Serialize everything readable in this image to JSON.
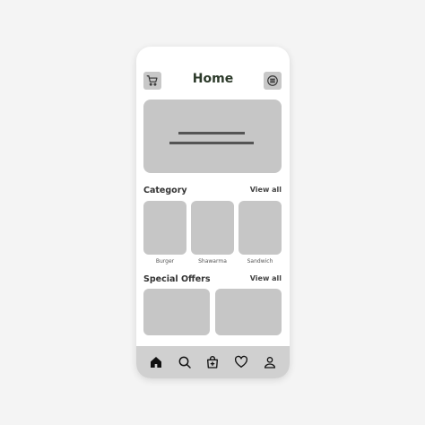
{
  "header": {
    "title": "Home",
    "cart_icon": "cart-icon",
    "menu_icon": "menu-icon"
  },
  "category": {
    "title": "Category",
    "view_all": "View all",
    "items": [
      {
        "label": "Burger"
      },
      {
        "label": "Shawarma"
      },
      {
        "label": "Sandwich"
      }
    ]
  },
  "special_offers": {
    "title": "Special Offers",
    "view_all": "View all"
  },
  "bottom_nav": {
    "items": [
      {
        "icon": "home-icon"
      },
      {
        "icon": "search-icon"
      },
      {
        "icon": "bag-icon"
      },
      {
        "icon": "heart-icon"
      },
      {
        "icon": "user-icon"
      }
    ]
  },
  "colors": {
    "background": "#f4f4f4",
    "title": "#2c3a2a",
    "placeholder": "#c6c6c6",
    "nav_bar": "#d0d0d0"
  }
}
